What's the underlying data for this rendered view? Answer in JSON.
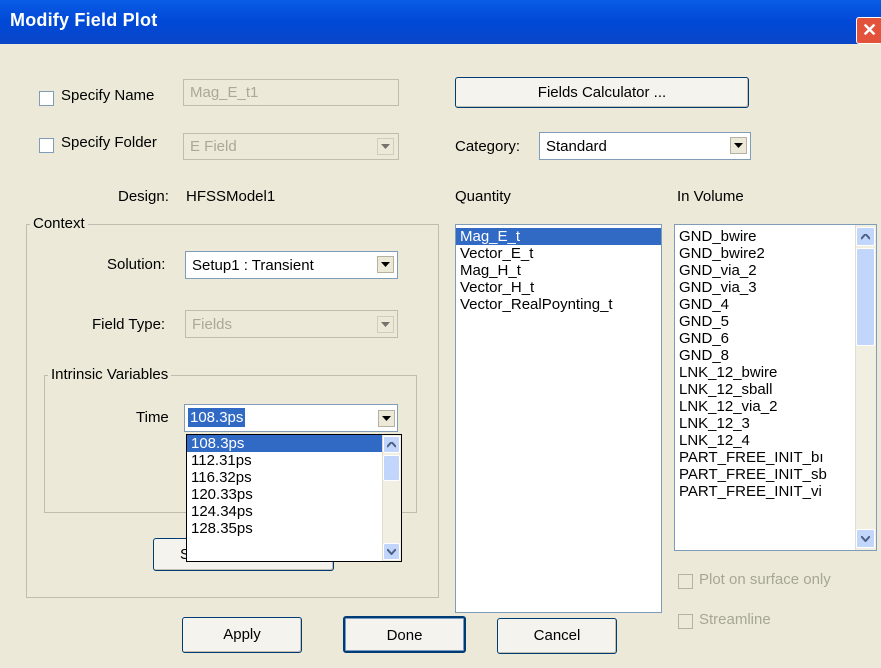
{
  "window": {
    "title": "Modify Field Plot",
    "close": "✕"
  },
  "specify_name": {
    "label": "Specify Name",
    "value": "Mag_E_t1"
  },
  "specify_folder": {
    "label": "Specify Folder",
    "value": "E Field"
  },
  "fields_calculator": {
    "label": "Fields Calculator ..."
  },
  "category": {
    "label": "Category:",
    "value": "Standard"
  },
  "design": {
    "label": "Design:",
    "value": "HFSSModel1"
  },
  "context": {
    "label": "Context",
    "solution_label": "Solution:",
    "solution_value": "Setup1 : Transient",
    "field_type_label": "Field Type:",
    "field_type_value": "Fields"
  },
  "intrinsic": {
    "label": "Intrinsic Variables",
    "time_label": "Time",
    "time_value": "108.3ps",
    "options": [
      "108.3ps",
      "112.31ps",
      "116.32ps",
      "120.33ps",
      "124.34ps",
      "128.35ps"
    ],
    "hidden_button_fragment": "S"
  },
  "quantity": {
    "label": "Quantity",
    "items": [
      "Mag_E_t",
      "Vector_E_t",
      "Mag_H_t",
      "Vector_H_t",
      "Vector_RealPoynting_t"
    ]
  },
  "in_volume": {
    "label": "In Volume",
    "items": [
      "GND_bwire",
      "GND_bwire2",
      "GND_via_2",
      "GND_via_3",
      "GND_4",
      "GND_5",
      "GND_6",
      "GND_8",
      "LNK_12_bwire",
      "LNK_12_sball",
      "LNK_12_via_2",
      "LNK_12_3",
      "LNK_12_4",
      "PART_FREE_INIT_bı",
      "PART_FREE_INIT_sb",
      "PART_FREE_INIT_vi"
    ]
  },
  "options": {
    "plot_on_surface": "Plot on surface only",
    "streamline": "Streamline"
  },
  "buttons": {
    "apply": "Apply",
    "done": "Done",
    "cancel": "Cancel"
  },
  "colors": {
    "titlebar": "#0054e3",
    "selection": "#316ac5",
    "dialog_bg": "#ece9d8"
  }
}
